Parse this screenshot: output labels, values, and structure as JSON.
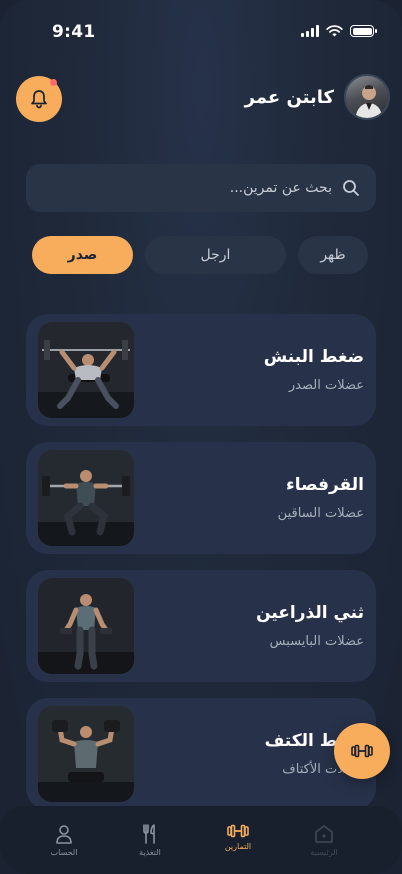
{
  "status_bar": {
    "time": "9:41"
  },
  "header": {
    "coach_name": "كابتن عمر"
  },
  "search": {
    "placeholder": "بحث عن تمرين..."
  },
  "filters": [
    {
      "label": "ظهر",
      "active": false
    },
    {
      "label": "ارجل",
      "active": false
    },
    {
      "label": "صدر",
      "active": true
    }
  ],
  "exercises": [
    {
      "title": "ضغط البنش",
      "subtitle": "عضلات الصدر"
    },
    {
      "title": "القرفصاء",
      "subtitle": "عضلات الساقين"
    },
    {
      "title": "ثني الذراعين",
      "subtitle": "عضلات البايسبس"
    },
    {
      "title": "ضغط الكتف",
      "subtitle": "عضلات الأكتاف"
    }
  ],
  "bottom_nav": [
    {
      "label": "الحساب",
      "icon": "user-icon",
      "active": false
    },
    {
      "label": "التغذية",
      "icon": "utensils-icon",
      "active": false
    },
    {
      "label": "التمارين",
      "icon": "dumbbell-icon",
      "active": true
    },
    {
      "label": "الرئيسية",
      "icon": "home-icon",
      "active": false
    }
  ],
  "colors": {
    "accent": "#f7ad5c",
    "background": "#1f2939",
    "card": "#27324a"
  }
}
